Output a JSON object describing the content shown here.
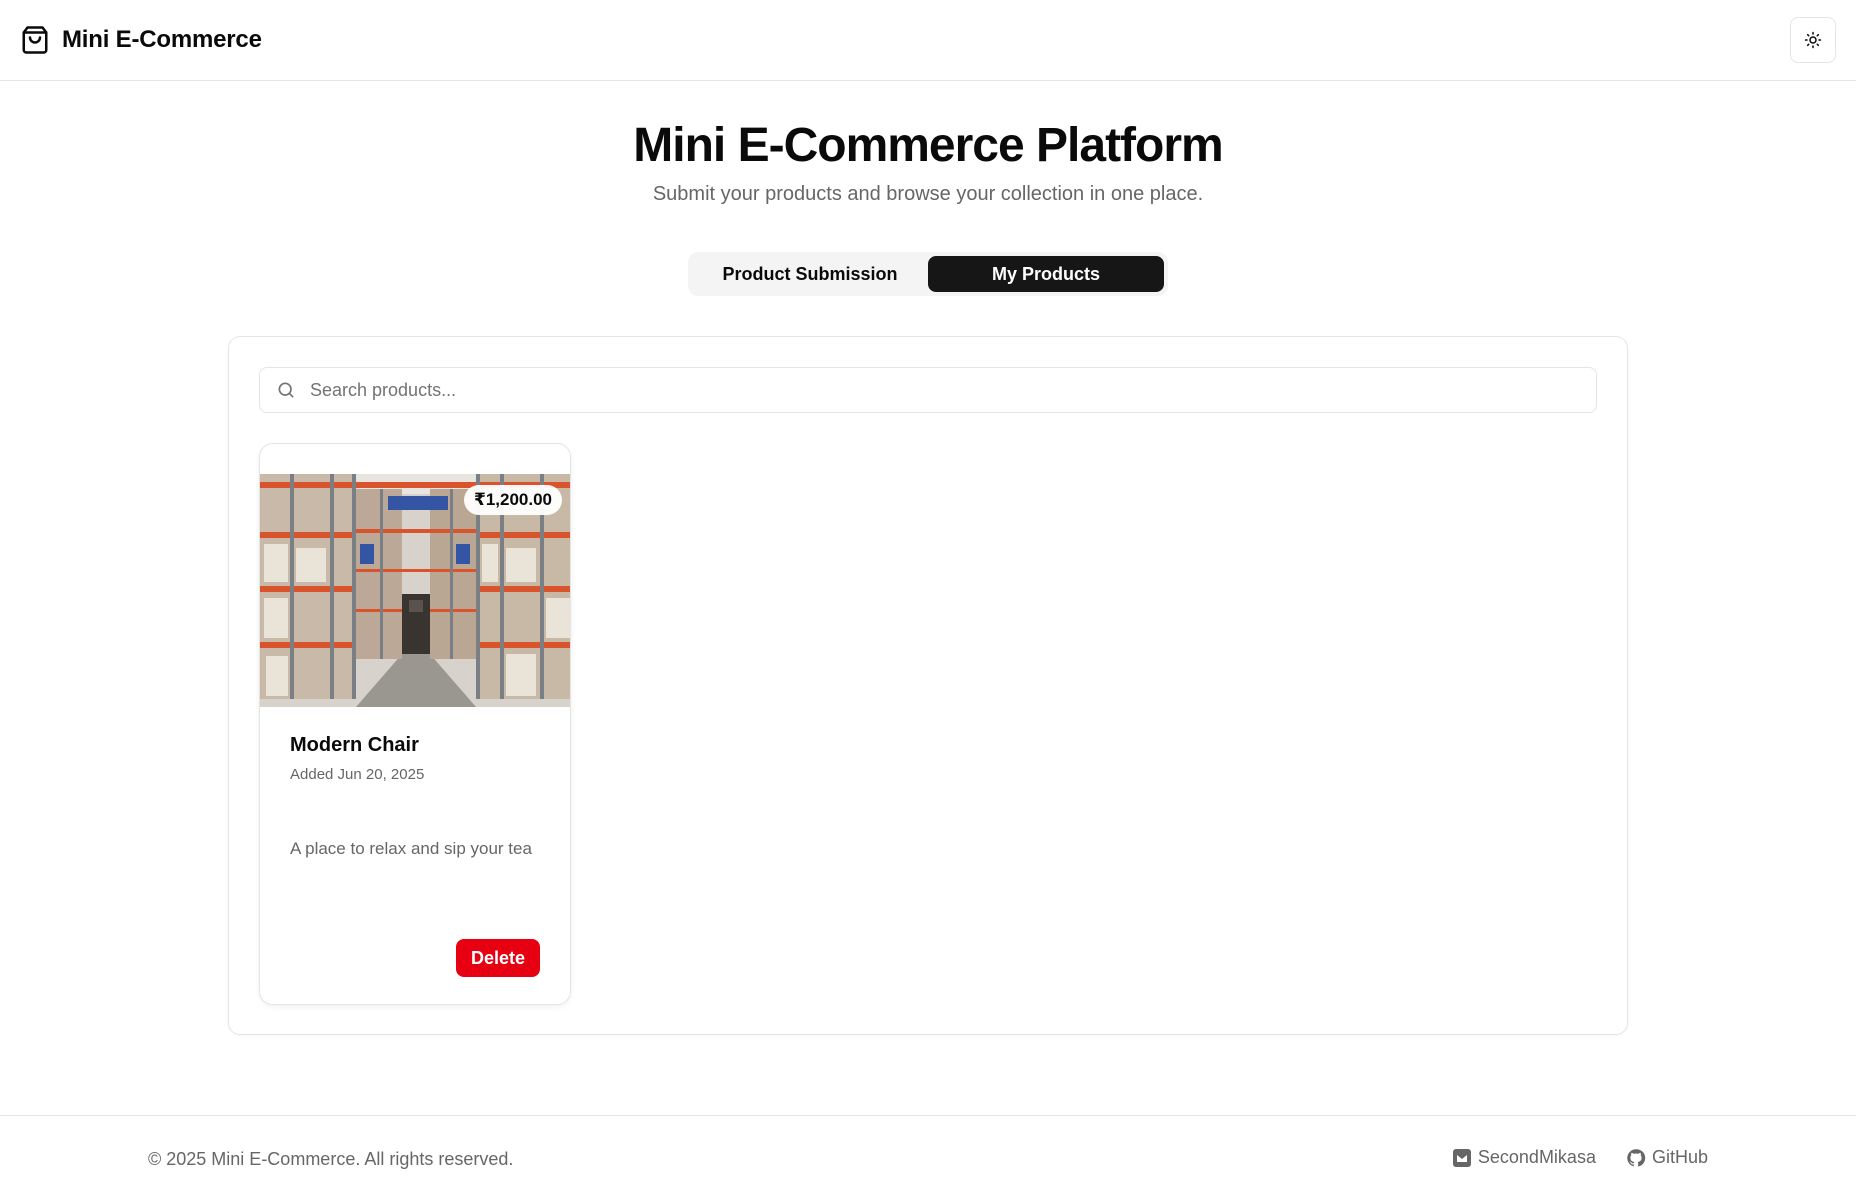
{
  "header": {
    "brand": "Mini E-Commerce",
    "brand_icon": "shopping-bag-icon",
    "theme_toggle_icon": "sun-icon"
  },
  "hero": {
    "title": "Mini E-Commerce Platform",
    "subtitle": "Submit your products and browse your collection in one place."
  },
  "tabs": [
    {
      "label": "Product Submission",
      "active": false
    },
    {
      "label": "My Products",
      "active": true
    }
  ],
  "search": {
    "placeholder": "Search products...",
    "value": ""
  },
  "products": [
    {
      "price": "₹1,200.00",
      "name": "Modern Chair",
      "date": "Added Jun 20, 2025",
      "description": "A place to relax and sip your tea",
      "delete_label": "Delete"
    }
  ],
  "footer": {
    "copyright": "© 2025 Mini E-Commerce. All rights reserved.",
    "links": [
      {
        "label": "SecondMikasa",
        "icon": "badge-icon"
      },
      {
        "label": "GitHub",
        "icon": "github-icon"
      }
    ]
  },
  "colors": {
    "accent_dark": "#161616",
    "danger": "#e60012",
    "muted_text": "#666666",
    "border": "#e5e5e5"
  }
}
